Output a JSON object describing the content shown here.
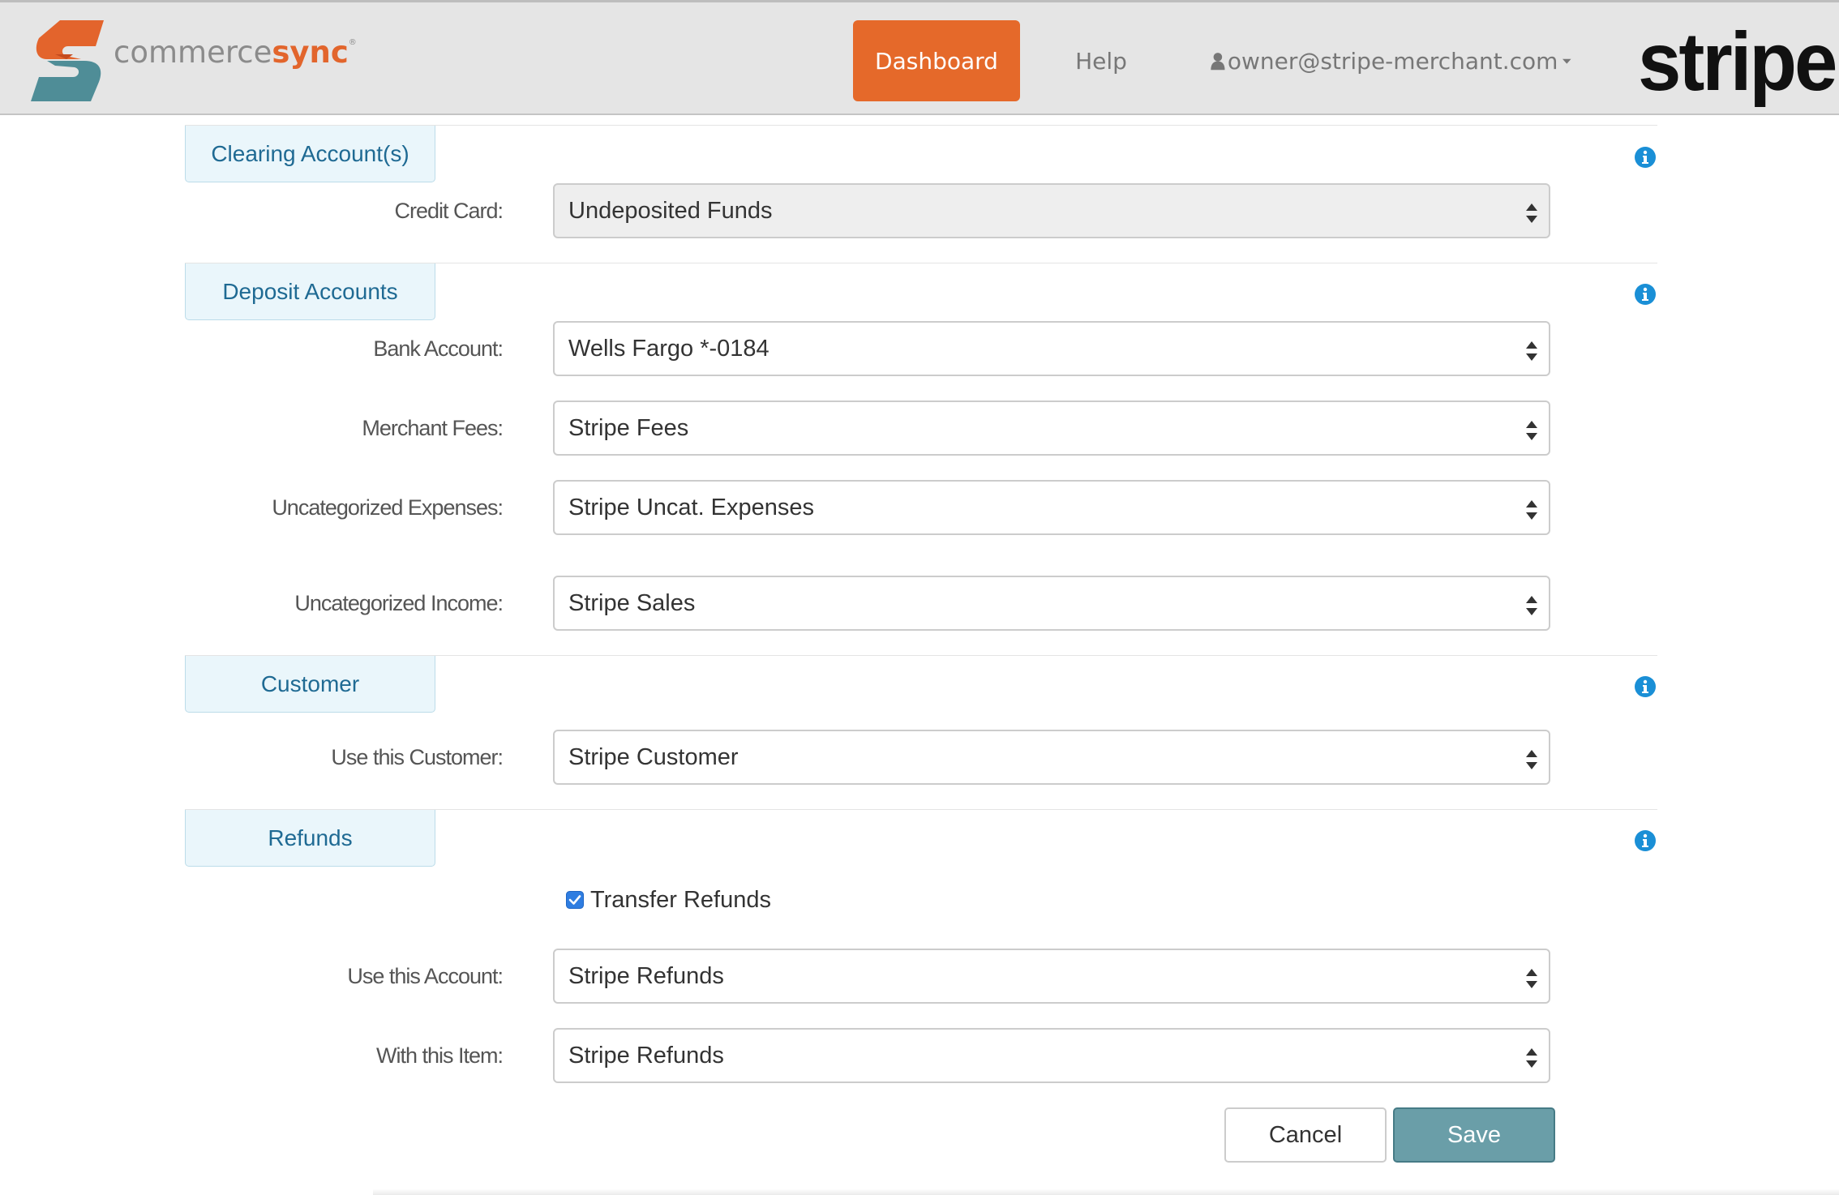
{
  "header": {
    "brand_part1": "commerce",
    "brand_part2": "sync",
    "brand_mark": "®",
    "nav": {
      "dashboard": "Dashboard",
      "help": "Help",
      "user_email": "owner@stripe-merchant.com"
    },
    "partner_logo": "stripe",
    "accent_color": "#e5692a"
  },
  "sections": {
    "clearing": {
      "title": "Clearing Account(s)",
      "credit_card_label": "Credit Card:",
      "credit_card_value": "Undeposited Funds"
    },
    "deposit": {
      "title": "Deposit Accounts",
      "bank_account_label": "Bank Account:",
      "bank_account_value": "Wells Fargo *-0184",
      "merchant_fees_label": "Merchant Fees:",
      "merchant_fees_value": "Stripe Fees",
      "uncat_expenses_label": "Uncategorized Expenses:",
      "uncat_expenses_value": "Stripe Uncat. Expenses",
      "uncat_income_label": "Uncategorized Income:",
      "uncat_income_value": "Stripe Sales"
    },
    "customer": {
      "title": "Customer",
      "use_customer_label": "Use this Customer:",
      "use_customer_value": "Stripe Customer"
    },
    "refunds": {
      "title": "Refunds",
      "transfer_refunds_label": "Transfer Refunds",
      "transfer_refunds_checked": true,
      "use_account_label": "Use this Account:",
      "use_account_value": "Stripe Refunds",
      "with_item_label": "With this Item:",
      "with_item_value": "Stripe Refunds"
    }
  },
  "actions": {
    "cancel": "Cancel",
    "save": "Save"
  },
  "icons": [
    "brand-logo-icon",
    "user-icon",
    "chevron-down-icon",
    "info-icon",
    "select-arrows-icon",
    "checkbox-checked-icon"
  ],
  "colors": {
    "section_title": "#1f6a93",
    "info_icon": "#1a8fd6",
    "save_button": "#6a9ea8",
    "header_bg": "#e5e5e5"
  }
}
